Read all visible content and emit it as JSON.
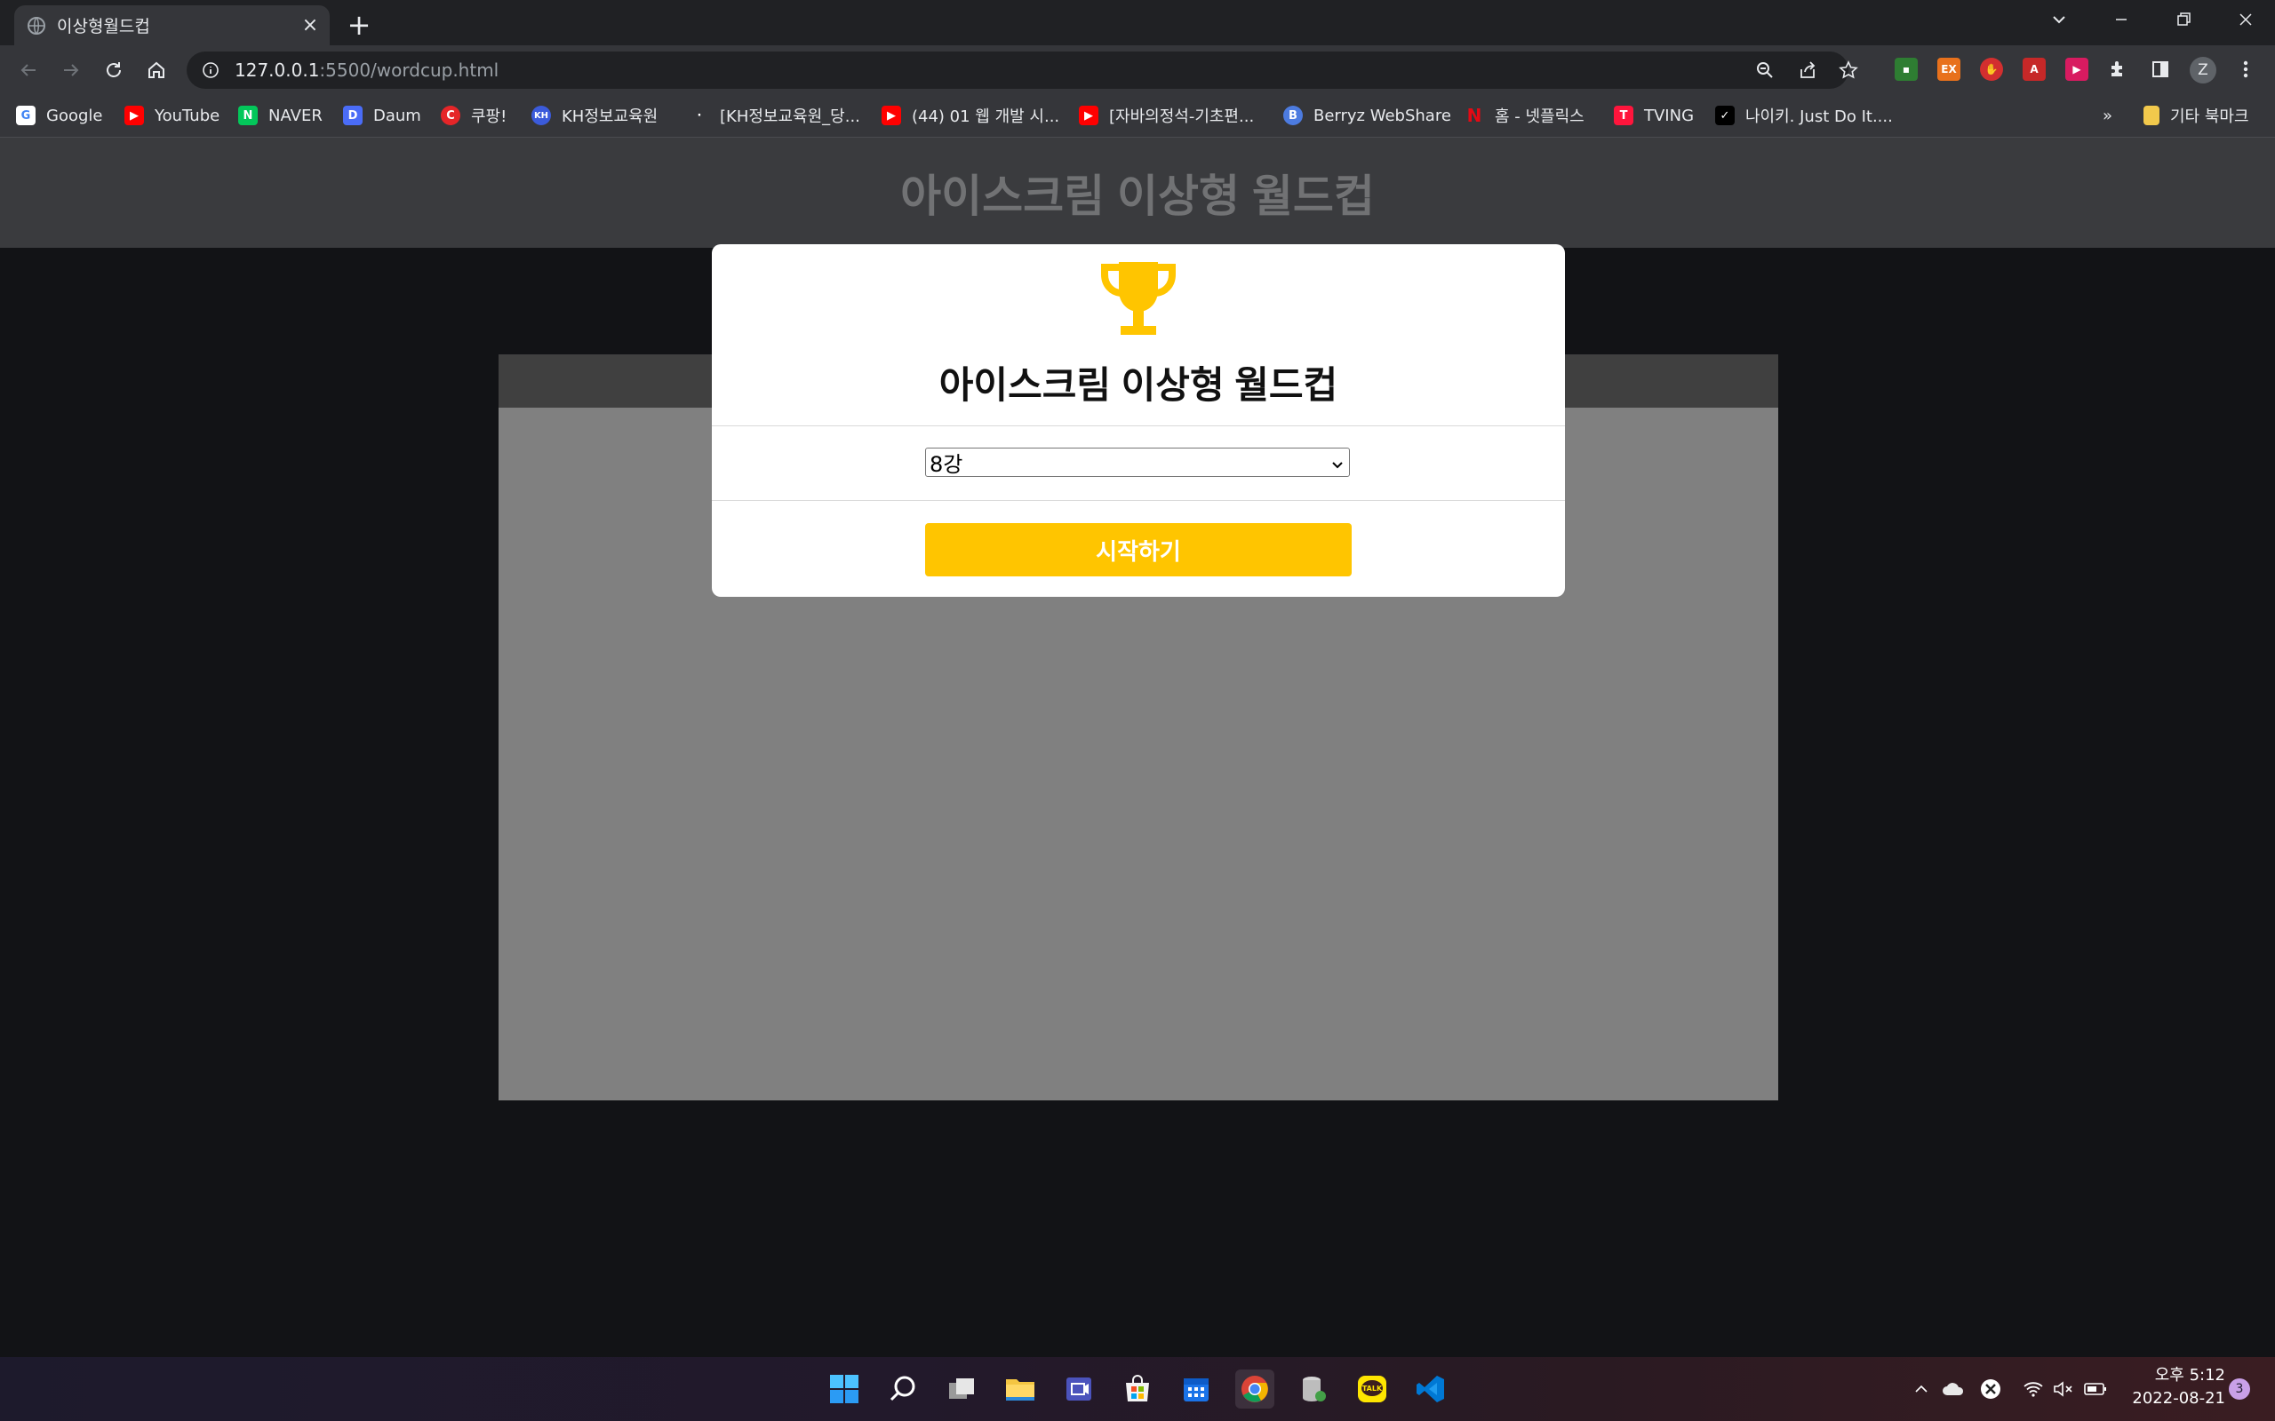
{
  "browser": {
    "tab": {
      "title": "이상형월드컵",
      "close_icon": "×"
    },
    "new_tab_icon": "+",
    "address": {
      "host": "127.0.0.1",
      "path": ":5500/wordcup.html"
    },
    "profile_initial": "Z"
  },
  "bookmarks": {
    "items": [
      {
        "label": "Google",
        "icon": "G",
        "color": "#ffffff"
      },
      {
        "label": "YouTube",
        "icon": "▶",
        "color": "#ff0000"
      },
      {
        "label": "NAVER",
        "icon": "N",
        "color": "#03c75a"
      },
      {
        "label": "Daum",
        "icon": "D",
        "color": "#4a6cf7"
      },
      {
        "label": "쿠팡!",
        "icon": "C",
        "color": "#e52528"
      },
      {
        "label": "KH정보교육원",
        "icon": "KH",
        "color": "#3b5bdb"
      },
      {
        "label": "[KH정보교육원_당...",
        "icon": "·",
        "color": "#35363a"
      },
      {
        "label": "(44) 01 웹 개발 시...",
        "icon": "▶",
        "color": "#ff0000"
      },
      {
        "label": "[자바의정석-기초편...",
        "icon": "▶",
        "color": "#ff0000"
      },
      {
        "label": "Berryz WebShare",
        "icon": "B",
        "color": "#4c7be0"
      },
      {
        "label": "홈 - 넷플릭스",
        "icon": "N",
        "color": "#e50914"
      },
      {
        "label": "TVING",
        "icon": "T",
        "color": "#ff153c"
      },
      {
        "label": "나이키. Just Do It....",
        "icon": "✓",
        "color": "#000000"
      }
    ],
    "more": "»",
    "other_folder": "기타 북마크"
  },
  "page": {
    "header_title": "아이스크림 이상형 월드컵"
  },
  "modal": {
    "title": "아이스크림 이상형 월드컵",
    "round_select": {
      "selected": "8강"
    },
    "start_button": "시작하기",
    "accent_color": "#ffc500"
  },
  "taskbar": {
    "clock": {
      "period_time": "오후 5:12",
      "date": "2022-08-21"
    },
    "notification_count": "3"
  }
}
